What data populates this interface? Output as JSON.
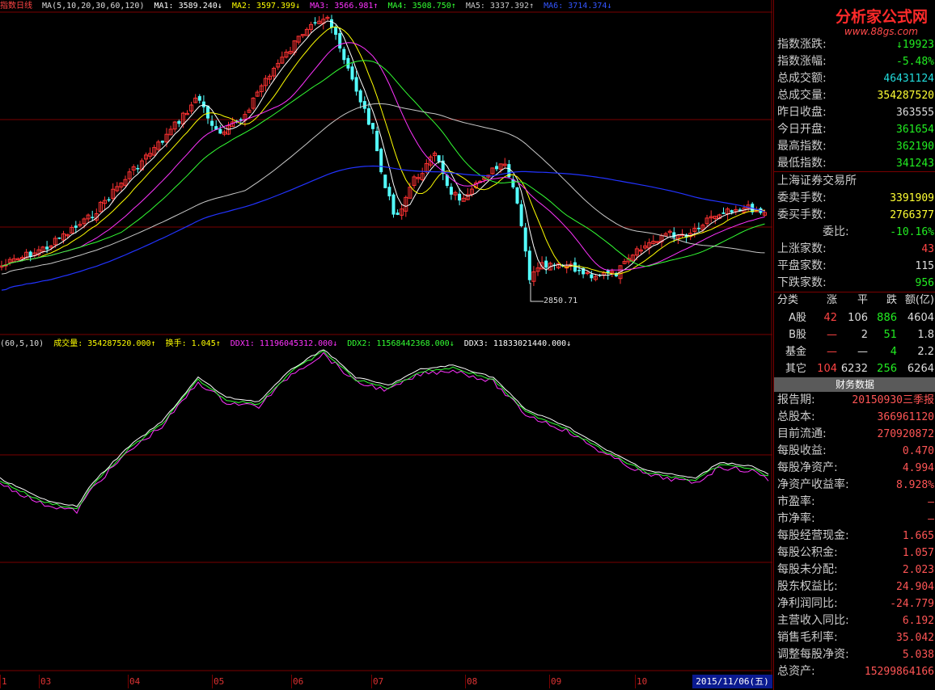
{
  "legend_top": {
    "title_prefix": "指数",
    "period": "日线",
    "ma_params": "MA(5,10,20,30,60,120)",
    "ma1": "MA1: 3589.240↓",
    "ma2": "MA2: 3597.399↓",
    "ma3": "MA3: 3566.981↑",
    "ma4": "MA4: 3508.750↑",
    "ma5": "MA5: 3337.392↑",
    "ma6": "MA6: 3714.374↓",
    "low_label": "2850.71"
  },
  "legend_bottom": {
    "params": "(60,5,10)",
    "volume": "成交量: 354287520.000↑",
    "turnover": "换手: 1.045↑",
    "ddx1": "DDX1: 11196045312.000↓",
    "ddx2": "DDX2: 11568442368.000↓",
    "ddx3": "DDX3: 11833021440.000↓"
  },
  "time_axis": [
    "1",
    "03",
    "04",
    "05",
    "06",
    "07",
    "08",
    "09",
    "10"
  ],
  "current_date": "2015/11/06(五)",
  "logo": {
    "name": "分析家公式网",
    "url": "www.88gs.com"
  },
  "quote": [
    {
      "label": "指数涨跌:",
      "value": "↓19923",
      "color": "#22ee22"
    },
    {
      "label": "指数涨幅:",
      "value": "-5.48%",
      "color": "#22ee22"
    },
    {
      "label": "总成交额:",
      "value": "46431124",
      "color": "#22dddd"
    },
    {
      "label": "总成交量:",
      "value": "354287520",
      "color": "#ffff33"
    },
    {
      "label": "昨日收盘:",
      "value": "363555",
      "color": "#dddddd"
    },
    {
      "label": "今日开盘:",
      "value": "361654",
      "color": "#22ee22"
    },
    {
      "label": "最高指数:",
      "value": "362190",
      "color": "#22ee22"
    },
    {
      "label": "最低指数:",
      "value": "341243",
      "color": "#22ee22"
    }
  ],
  "exchange_name": "上海证券交易所",
  "exchange": [
    {
      "label": "委卖手数:",
      "value": "3391909",
      "color": "#ffff33"
    },
    {
      "label": "委买手数:",
      "value": "2766377",
      "color": "#ffff33"
    },
    {
      "label": "委比:",
      "value": "-10.16%",
      "color": "#22ee22"
    },
    {
      "label": "上涨家数:",
      "value": "43",
      "color": "#ff4444"
    },
    {
      "label": "平盘家数:",
      "value": "115",
      "color": "#dddddd"
    },
    {
      "label": "下跌家数:",
      "value": "956",
      "color": "#22ee22"
    }
  ],
  "breakdown": {
    "headers": [
      "分类",
      "涨",
      "平",
      "跌",
      "额(亿)"
    ],
    "rows": [
      {
        "name": "A股",
        "up": "42",
        "flat": "106",
        "down": "886",
        "amount": "4604"
      },
      {
        "name": "B股",
        "up": "—",
        "flat": "2",
        "down": "51",
        "amount": "1.8"
      },
      {
        "name": "基金",
        "up": "—",
        "flat": "—",
        "down": "4",
        "amount": "2.2"
      },
      {
        "name": "其它",
        "up": "104",
        "flat": "6232",
        "down": "256",
        "amount": "6264"
      }
    ]
  },
  "finance_title": "财务数据",
  "finance": [
    {
      "label": "报告期:",
      "value": "20150930三季报"
    },
    {
      "label": "总股本:",
      "value": "366961120"
    },
    {
      "label": "目前流通:",
      "value": "270920872"
    },
    {
      "label": "每股收益:",
      "value": "0.470"
    },
    {
      "label": "每股净资产:",
      "value": "4.994"
    },
    {
      "label": "净资产收益率:",
      "value": "8.928%"
    },
    {
      "label": "市盈率:",
      "value": "—"
    },
    {
      "label": "市净率:",
      "value": "—"
    },
    {
      "label": "每股经营现金:",
      "value": "1.665"
    },
    {
      "label": "每股公积金:",
      "value": "1.057"
    },
    {
      "label": "每股未分配:",
      "value": "2.023"
    },
    {
      "label": "股东权益比:",
      "value": "24.904"
    },
    {
      "label": "净利润同比:",
      "value": "-24.779"
    },
    {
      "label": "主营收入同比:",
      "value": "6.192"
    },
    {
      "label": "销售毛利率:",
      "value": "35.042"
    },
    {
      "label": "调整每股净资:",
      "value": "5.038"
    },
    {
      "label": "总资产:",
      "value": "15299864166"
    }
  ],
  "colors": {
    "up": "#ff3232",
    "down": "#54ffff",
    "ma1": "#ffffff",
    "ma2": "#ffff00",
    "ma3": "#ff33ff",
    "ma4": "#33ff33",
    "ma5": "#c8c8c8",
    "ma6": "#2233ff",
    "grid": "#7a0000"
  }
}
